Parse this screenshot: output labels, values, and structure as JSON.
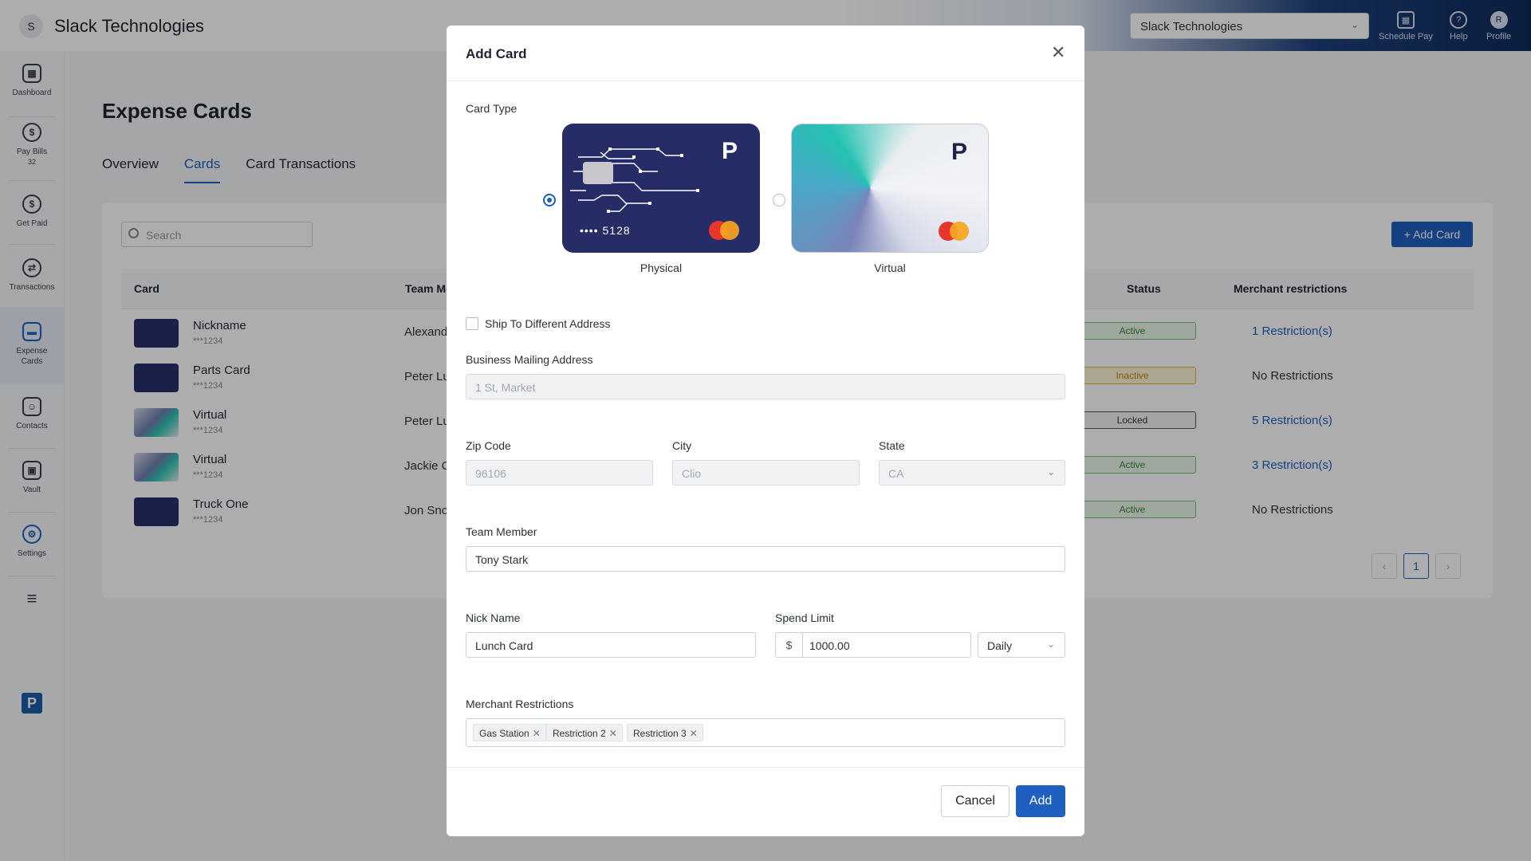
{
  "app": {
    "org_initial": "S",
    "org_name": "Slack Technologies",
    "org_select_value": "Slack Technologies"
  },
  "top_actions": {
    "schedule_pay": "Schedule Pay",
    "help": "Help",
    "profile": "Profile",
    "profile_initial": "R"
  },
  "sidebar": {
    "items": [
      {
        "label": "Dashboard"
      },
      {
        "label": "Pay Bills",
        "badge": "32"
      },
      {
        "label": "Get Paid"
      },
      {
        "label": "Transactions"
      },
      {
        "label": "Expense Cards"
      },
      {
        "label": "Contacts"
      },
      {
        "label": "Vault"
      },
      {
        "label": "Settings"
      }
    ],
    "logo_letter": "P"
  },
  "page": {
    "title": "Expense Cards",
    "tabs": [
      "Overview",
      "Cards",
      "Card Transactions"
    ],
    "active_tab": "Cards"
  },
  "table": {
    "search_placeholder": "Search",
    "add_card_label": "+ Add Card",
    "columns": [
      "Card",
      "Team Me",
      "Status",
      "Merchant restrictions"
    ],
    "rows": [
      {
        "name": "Nickname",
        "number": "***1234",
        "member": "Alexand",
        "status": "Active",
        "restrictions": "1 Restriction(s)"
      },
      {
        "name": "Parts Card",
        "number": "***1234",
        "member": "Peter Lu",
        "status": "Inactive",
        "restrictions": "No Restrictions"
      },
      {
        "name": "Virtual",
        "number": "***1234",
        "member": "Peter Lu",
        "status": "Locked",
        "restrictions": "5 Restriction(s)"
      },
      {
        "name": "Virtual",
        "number": "***1234",
        "member": "Jackie C",
        "status": "Active",
        "restrictions": "3 Restriction(s)"
      },
      {
        "name": "Truck One",
        "number": "***1234",
        "member": "Jon Sno",
        "status": "Active",
        "restrictions": "No Restrictions"
      }
    ],
    "current_page": "1",
    "colors": {
      "active": "#2f8a3a",
      "inactive": "#b88a10",
      "locked": "#333333",
      "link": "#1f5fbf"
    }
  },
  "modal": {
    "title": "Add Card",
    "card_type_label": "Card Type",
    "card_types": [
      {
        "label": "Physical",
        "masked_number": "•••• 5128",
        "selected": true
      },
      {
        "label": "Virtual",
        "selected": false
      }
    ],
    "ship_label": "Ship To Different Address",
    "address_label": "Business Mailing Address",
    "address_value": "1 St, Market",
    "zip_label": "Zip Code",
    "zip_value": "96106",
    "city_label": "City",
    "city_value": "Clio",
    "state_label": "State",
    "state_value": "CA",
    "team_member_label": "Team Member",
    "team_member_value": "Tony Stark",
    "nickname_label": "Nick Name",
    "nickname_value": "Lunch Card",
    "spend_limit_label": "Spend Limit",
    "currency_symbol": "$",
    "spend_limit_value": "1000.00",
    "spend_period": "Daily",
    "merchant_label": "Merchant Restrictions",
    "merchant_tags": [
      "Gas Station",
      "Restriction 2",
      "Restriction 3"
    ],
    "cancel_label": "Cancel",
    "add_label": "Add",
    "accent_color": "#1f5fbf"
  }
}
